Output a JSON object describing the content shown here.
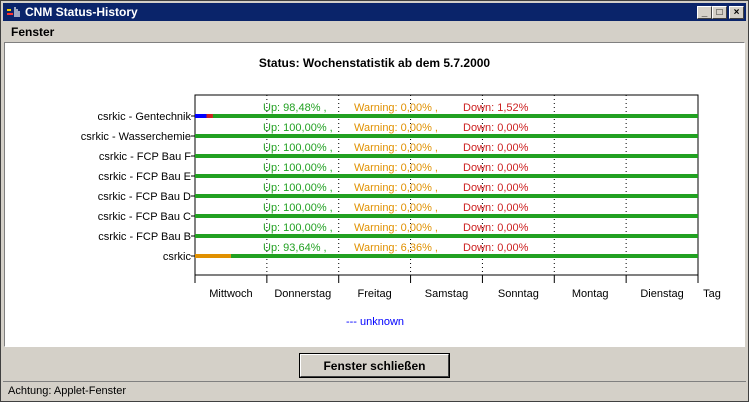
{
  "window": {
    "title": "CNM Status-History"
  },
  "menu": {
    "fenster": "Fenster"
  },
  "chart_data": {
    "type": "bar",
    "title": "Status: Wochenstatistik ab dem 5.7.2000",
    "x_axis_label": "Tag",
    "x_ticks": [
      "Mittwoch",
      "Donnerstag",
      "Freitag",
      "Samstag",
      "Sonntag",
      "Montag",
      "Dienstag"
    ],
    "legend": [
      {
        "name": "--- unknown",
        "color": "#0000ff"
      }
    ],
    "colors": {
      "up": "#22a022",
      "warning": "#e09000",
      "down": "#cc2020",
      "unknown": "#0000ff"
    },
    "rows": [
      {
        "name": "csrkic - Gentechnik",
        "up": "Up: 98,48% ,",
        "warning": "Warning: 0,00% ,",
        "down": "Down: 1,52%",
        "segments": [
          {
            "state": "unknown",
            "from": 0.0,
            "to": 0.16
          },
          {
            "state": "down",
            "from": 0.16,
            "to": 0.25
          },
          {
            "state": "up",
            "from": 0.25,
            "to": 7.0
          }
        ]
      },
      {
        "name": "csrkic - Wasserchemie",
        "up": "Up: 100,00% ,",
        "warning": "Warning: 0,00% ,",
        "down": "Down: 0,00%",
        "segments": [
          {
            "state": "up",
            "from": 0.0,
            "to": 7.0
          }
        ]
      },
      {
        "name": "csrkic - FCP Bau F",
        "up": "Up: 100,00% ,",
        "warning": "Warning: 0,00% ,",
        "down": "Down: 0,00%",
        "segments": [
          {
            "state": "up",
            "from": 0.0,
            "to": 7.0
          }
        ]
      },
      {
        "name": "csrkic - FCP Bau E",
        "up": "Up: 100,00% ,",
        "warning": "Warning: 0,00% ,",
        "down": "Down: 0,00%",
        "segments": [
          {
            "state": "up",
            "from": 0.0,
            "to": 7.0
          }
        ]
      },
      {
        "name": "csrkic - FCP Bau D",
        "up": "Up: 100,00% ,",
        "warning": "Warning: 0,00% ,",
        "down": "Down: 0,00%",
        "segments": [
          {
            "state": "up",
            "from": 0.0,
            "to": 7.0
          }
        ]
      },
      {
        "name": "csrkic - FCP Bau C",
        "up": "Up: 100,00% ,",
        "warning": "Warning: 0,00% ,",
        "down": "Down: 0,00%",
        "segments": [
          {
            "state": "up",
            "from": 0.0,
            "to": 7.0
          }
        ]
      },
      {
        "name": "csrkic - FCP Bau B",
        "up": "Up: 100,00% ,",
        "warning": "Warning: 0,00% ,",
        "down": "Down: 0,00%",
        "segments": [
          {
            "state": "up",
            "from": 0.0,
            "to": 7.0
          }
        ]
      },
      {
        "name": "csrkic",
        "up": "Up: 93,64% ,",
        "warning": "Warning: 6,36% ,",
        "down": "Down: 0,00%",
        "segments": [
          {
            "state": "warning",
            "from": 0.0,
            "to": 0.5
          },
          {
            "state": "up",
            "from": 0.5,
            "to": 7.0
          }
        ]
      }
    ]
  },
  "buttons": {
    "close": "Fenster schließen"
  },
  "status": {
    "text": "Achtung: Applet-Fenster"
  }
}
